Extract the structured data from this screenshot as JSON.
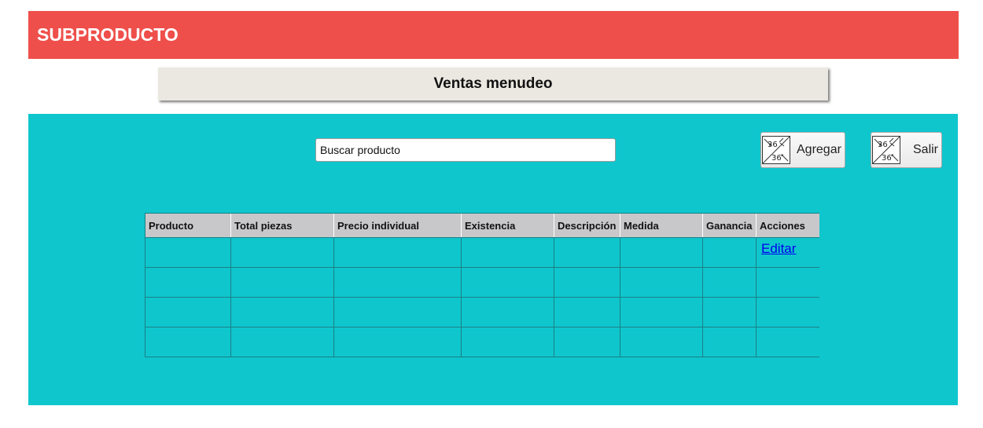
{
  "header": {
    "title": "SUBPRODUCTO",
    "bg_color": "#ef4f4b"
  },
  "subtitle": {
    "text": "Ventas menudeo"
  },
  "panel": {
    "bg_color": "#0fc6cd"
  },
  "search": {
    "placeholder": "Buscar producto",
    "value": ""
  },
  "buttons": {
    "add": {
      "label": "Agregar",
      "icon": "broken-image-icon"
    },
    "exit": {
      "label": "Salir",
      "icon": "broken-image-icon"
    }
  },
  "table": {
    "columns": [
      "Producto",
      "Total piezas",
      "Precio individual",
      "Existencia",
      "Descripción",
      "Medida",
      "Ganancia",
      "Acciones"
    ],
    "rows": [
      {
        "cells": [
          "",
          "",
          "",
          "",
          "",
          "",
          ""
        ],
        "action": "Editar"
      },
      {
        "cells": [
          "",
          "",
          "",
          "",
          "",
          "",
          ""
        ],
        "action": ""
      },
      {
        "cells": [
          "",
          "",
          "",
          "",
          "",
          "",
          ""
        ],
        "action": ""
      },
      {
        "cells": [
          "",
          "",
          "",
          "",
          "",
          "",
          ""
        ],
        "action": ""
      }
    ]
  }
}
